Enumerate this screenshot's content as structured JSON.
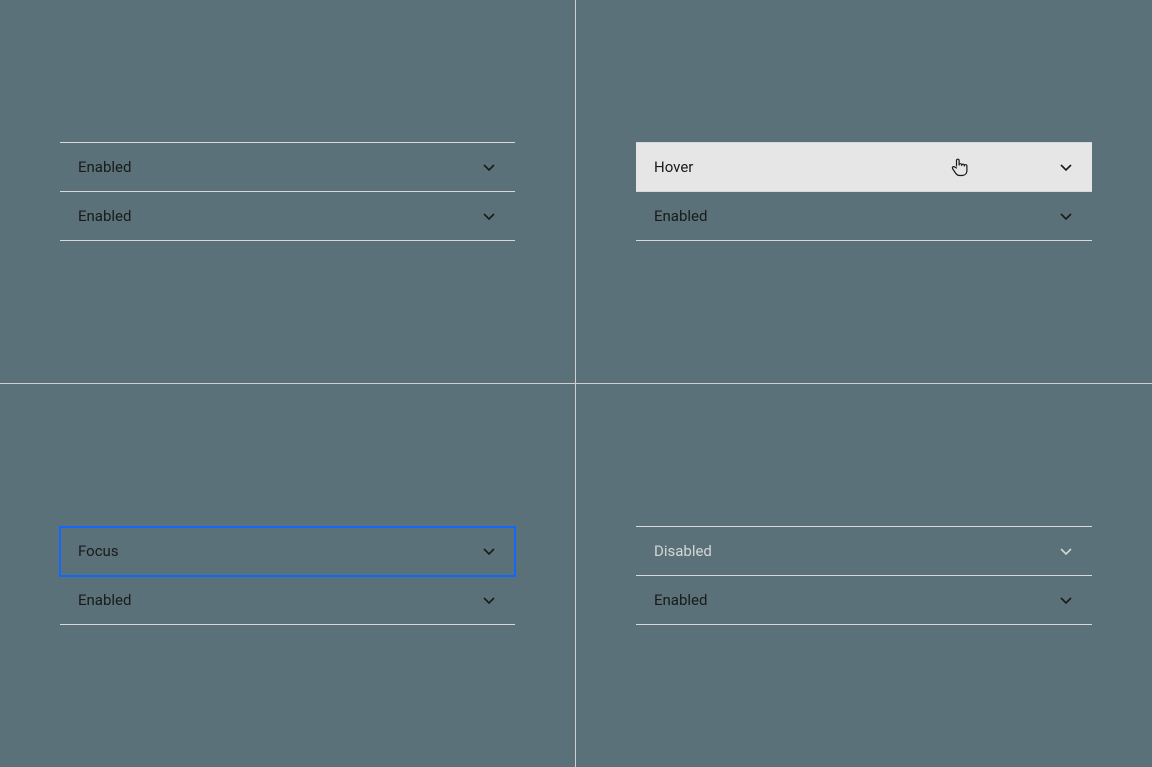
{
  "quadrants": {
    "top_left": {
      "item1": {
        "label": "Enabled"
      },
      "item2": {
        "label": "Enabled"
      }
    },
    "top_right": {
      "item1": {
        "label": "Hover"
      },
      "item2": {
        "label": "Enabled"
      }
    },
    "bottom_left": {
      "item1": {
        "label": "Focus"
      },
      "item2": {
        "label": "Enabled"
      }
    },
    "bottom_right": {
      "item1": {
        "label": "Disabled"
      },
      "item2": {
        "label": "Enabled"
      }
    }
  },
  "colors": {
    "background": "#5A7179",
    "divider": "#D0D0D0",
    "hover_bg": "#E6E6E6",
    "focus_ring": "#1268FB",
    "text": "#1A1A1A",
    "disabled": "#D4D6D7"
  }
}
